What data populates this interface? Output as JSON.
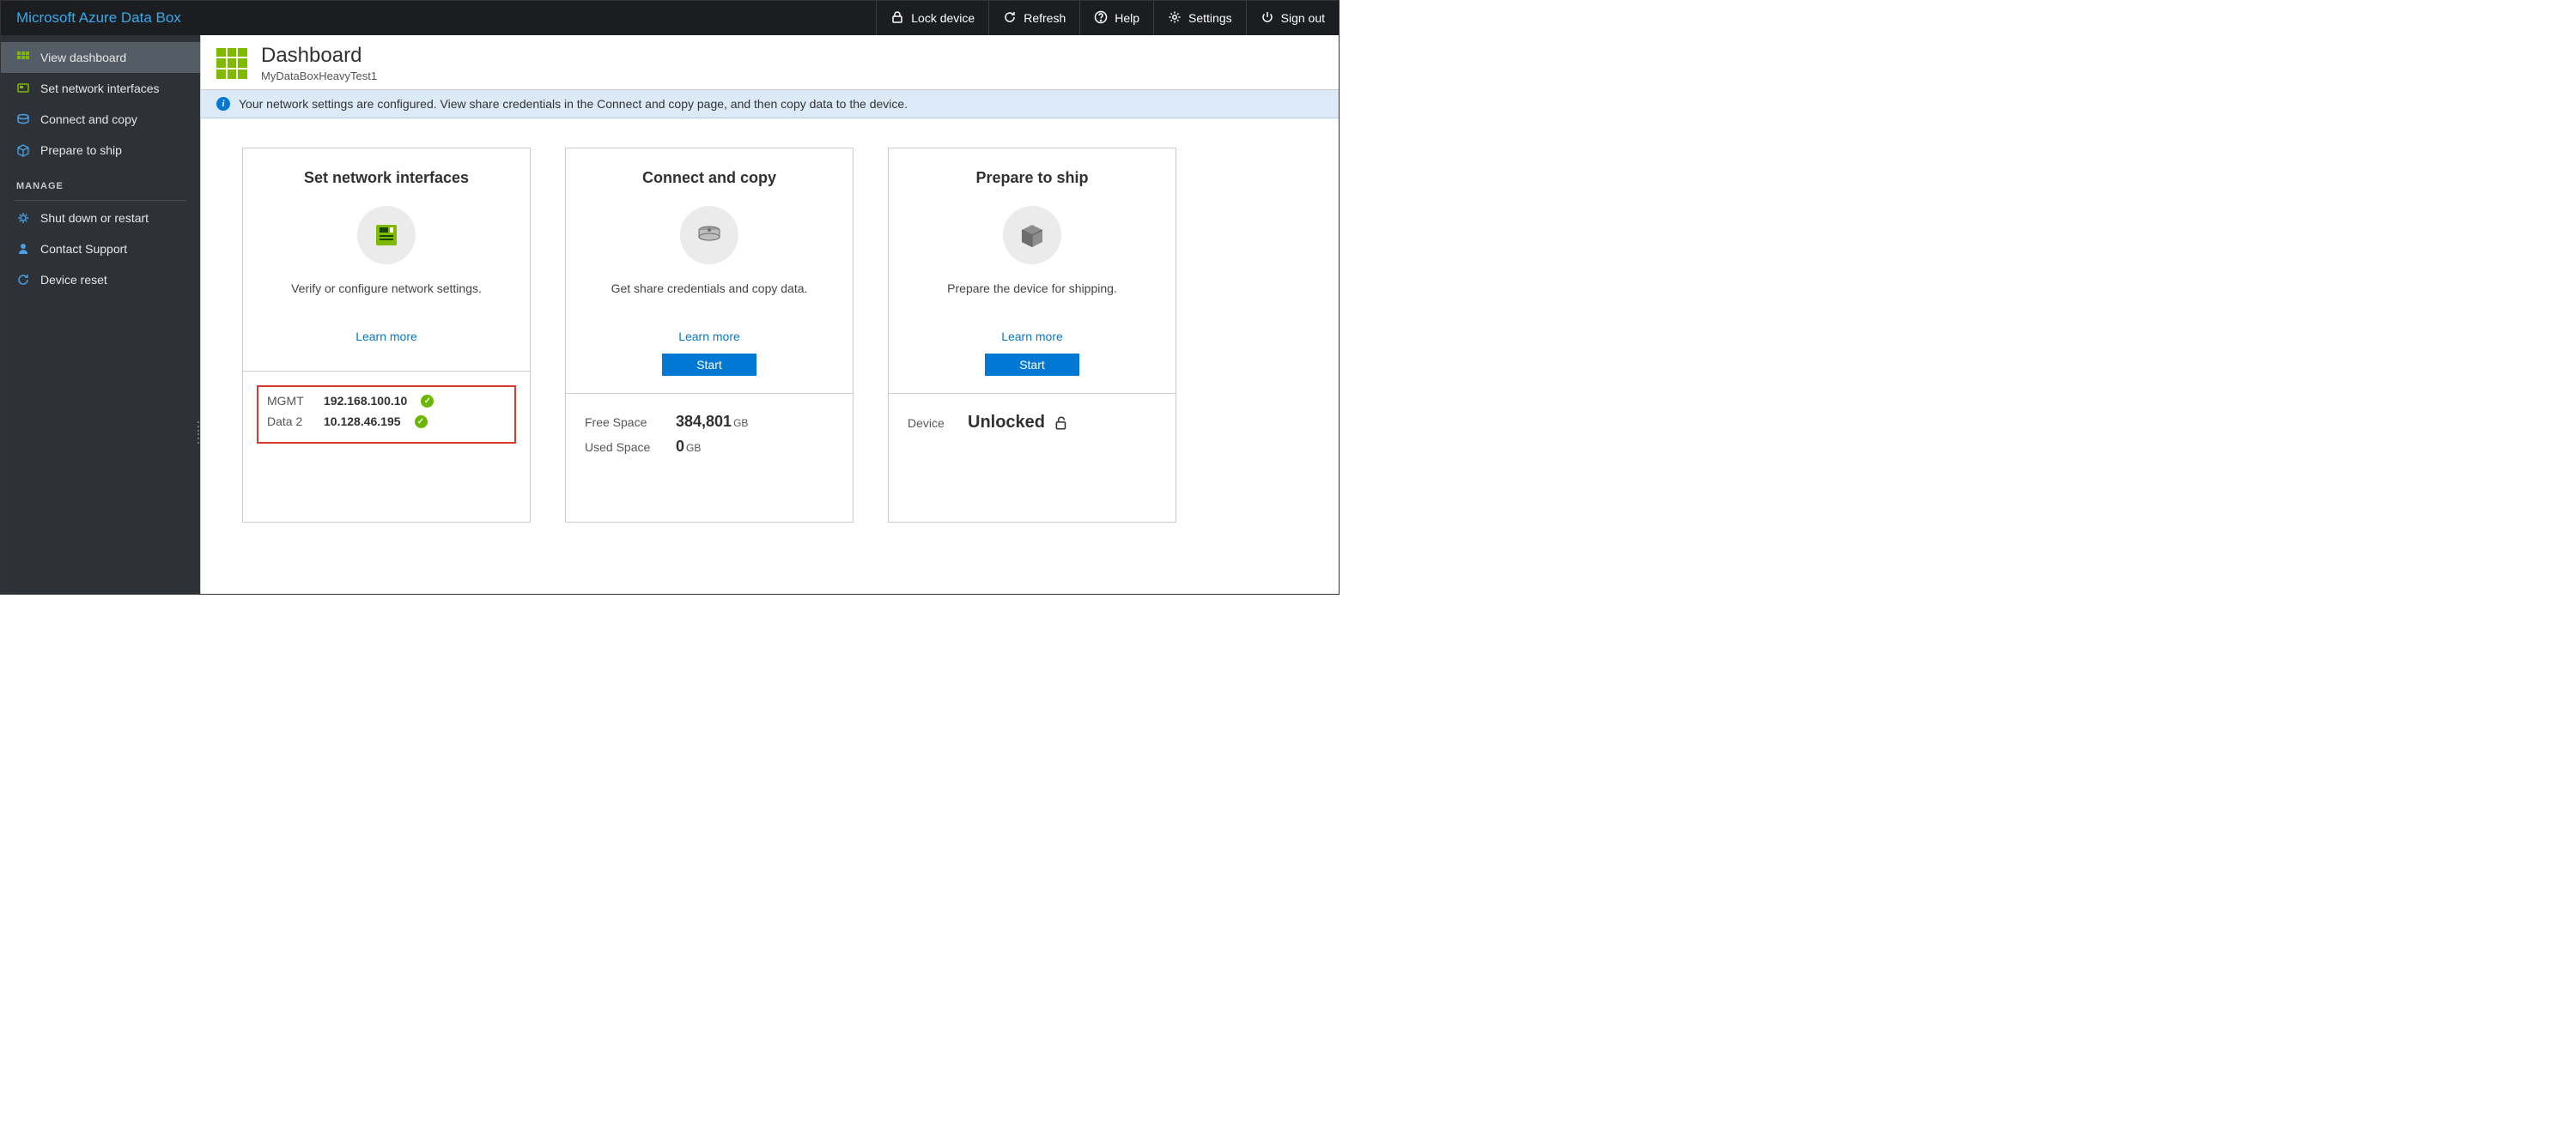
{
  "brand": "Microsoft Azure Data Box",
  "header": {
    "lock": "Lock device",
    "refresh": "Refresh",
    "help": "Help",
    "settings": "Settings",
    "signout": "Sign out"
  },
  "sidebar": {
    "items": [
      {
        "label": "View dashboard"
      },
      {
        "label": "Set network interfaces"
      },
      {
        "label": "Connect and copy"
      },
      {
        "label": "Prepare to ship"
      }
    ],
    "manage_heading": "MANAGE",
    "manage_items": [
      {
        "label": "Shut down or restart"
      },
      {
        "label": "Contact Support"
      },
      {
        "label": "Device reset"
      }
    ]
  },
  "page": {
    "title": "Dashboard",
    "subtitle": "MyDataBoxHeavyTest1",
    "info": "Your network settings are configured. View share credentials in the Connect and copy page, and then copy data to the device."
  },
  "cards": {
    "network": {
      "title": "Set network interfaces",
      "desc": "Verify or configure network settings.",
      "learn": "Learn more",
      "rows": [
        {
          "label": "MGMT",
          "value": "192.168.100.10"
        },
        {
          "label": "Data 2",
          "value": "10.128.46.195"
        }
      ]
    },
    "copy": {
      "title": "Connect and copy",
      "desc": "Get share credentials and copy data.",
      "learn": "Learn more",
      "start": "Start",
      "free_label": "Free Space",
      "free_value": "384,801",
      "free_unit": "GB",
      "used_label": "Used Space",
      "used_value": "0",
      "used_unit": "GB"
    },
    "ship": {
      "title": "Prepare to ship",
      "desc": "Prepare the device for shipping.",
      "learn": "Learn more",
      "start": "Start",
      "device_label": "Device",
      "device_state": "Unlocked"
    }
  }
}
